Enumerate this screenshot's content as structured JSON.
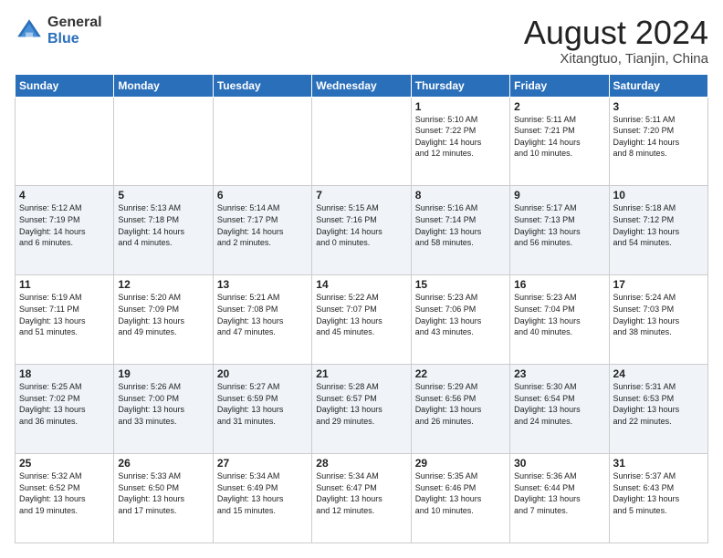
{
  "header": {
    "logo_general": "General",
    "logo_blue": "Blue",
    "month_year": "August 2024",
    "location": "Xitangtuo, Tianjin, China"
  },
  "days_of_week": [
    "Sunday",
    "Monday",
    "Tuesday",
    "Wednesday",
    "Thursday",
    "Friday",
    "Saturday"
  ],
  "weeks": [
    [
      {
        "day": "",
        "info": ""
      },
      {
        "day": "",
        "info": ""
      },
      {
        "day": "",
        "info": ""
      },
      {
        "day": "",
        "info": ""
      },
      {
        "day": "1",
        "info": "Sunrise: 5:10 AM\nSunset: 7:22 PM\nDaylight: 14 hours\nand 12 minutes."
      },
      {
        "day": "2",
        "info": "Sunrise: 5:11 AM\nSunset: 7:21 PM\nDaylight: 14 hours\nand 10 minutes."
      },
      {
        "day": "3",
        "info": "Sunrise: 5:11 AM\nSunset: 7:20 PM\nDaylight: 14 hours\nand 8 minutes."
      }
    ],
    [
      {
        "day": "4",
        "info": "Sunrise: 5:12 AM\nSunset: 7:19 PM\nDaylight: 14 hours\nand 6 minutes."
      },
      {
        "day": "5",
        "info": "Sunrise: 5:13 AM\nSunset: 7:18 PM\nDaylight: 14 hours\nand 4 minutes."
      },
      {
        "day": "6",
        "info": "Sunrise: 5:14 AM\nSunset: 7:17 PM\nDaylight: 14 hours\nand 2 minutes."
      },
      {
        "day": "7",
        "info": "Sunrise: 5:15 AM\nSunset: 7:16 PM\nDaylight: 14 hours\nand 0 minutes."
      },
      {
        "day": "8",
        "info": "Sunrise: 5:16 AM\nSunset: 7:14 PM\nDaylight: 13 hours\nand 58 minutes."
      },
      {
        "day": "9",
        "info": "Sunrise: 5:17 AM\nSunset: 7:13 PM\nDaylight: 13 hours\nand 56 minutes."
      },
      {
        "day": "10",
        "info": "Sunrise: 5:18 AM\nSunset: 7:12 PM\nDaylight: 13 hours\nand 54 minutes."
      }
    ],
    [
      {
        "day": "11",
        "info": "Sunrise: 5:19 AM\nSunset: 7:11 PM\nDaylight: 13 hours\nand 51 minutes."
      },
      {
        "day": "12",
        "info": "Sunrise: 5:20 AM\nSunset: 7:09 PM\nDaylight: 13 hours\nand 49 minutes."
      },
      {
        "day": "13",
        "info": "Sunrise: 5:21 AM\nSunset: 7:08 PM\nDaylight: 13 hours\nand 47 minutes."
      },
      {
        "day": "14",
        "info": "Sunrise: 5:22 AM\nSunset: 7:07 PM\nDaylight: 13 hours\nand 45 minutes."
      },
      {
        "day": "15",
        "info": "Sunrise: 5:23 AM\nSunset: 7:06 PM\nDaylight: 13 hours\nand 43 minutes."
      },
      {
        "day": "16",
        "info": "Sunrise: 5:23 AM\nSunset: 7:04 PM\nDaylight: 13 hours\nand 40 minutes."
      },
      {
        "day": "17",
        "info": "Sunrise: 5:24 AM\nSunset: 7:03 PM\nDaylight: 13 hours\nand 38 minutes."
      }
    ],
    [
      {
        "day": "18",
        "info": "Sunrise: 5:25 AM\nSunset: 7:02 PM\nDaylight: 13 hours\nand 36 minutes."
      },
      {
        "day": "19",
        "info": "Sunrise: 5:26 AM\nSunset: 7:00 PM\nDaylight: 13 hours\nand 33 minutes."
      },
      {
        "day": "20",
        "info": "Sunrise: 5:27 AM\nSunset: 6:59 PM\nDaylight: 13 hours\nand 31 minutes."
      },
      {
        "day": "21",
        "info": "Sunrise: 5:28 AM\nSunset: 6:57 PM\nDaylight: 13 hours\nand 29 minutes."
      },
      {
        "day": "22",
        "info": "Sunrise: 5:29 AM\nSunset: 6:56 PM\nDaylight: 13 hours\nand 26 minutes."
      },
      {
        "day": "23",
        "info": "Sunrise: 5:30 AM\nSunset: 6:54 PM\nDaylight: 13 hours\nand 24 minutes."
      },
      {
        "day": "24",
        "info": "Sunrise: 5:31 AM\nSunset: 6:53 PM\nDaylight: 13 hours\nand 22 minutes."
      }
    ],
    [
      {
        "day": "25",
        "info": "Sunrise: 5:32 AM\nSunset: 6:52 PM\nDaylight: 13 hours\nand 19 minutes."
      },
      {
        "day": "26",
        "info": "Sunrise: 5:33 AM\nSunset: 6:50 PM\nDaylight: 13 hours\nand 17 minutes."
      },
      {
        "day": "27",
        "info": "Sunrise: 5:34 AM\nSunset: 6:49 PM\nDaylight: 13 hours\nand 15 minutes."
      },
      {
        "day": "28",
        "info": "Sunrise: 5:34 AM\nSunset: 6:47 PM\nDaylight: 13 hours\nand 12 minutes."
      },
      {
        "day": "29",
        "info": "Sunrise: 5:35 AM\nSunset: 6:46 PM\nDaylight: 13 hours\nand 10 minutes."
      },
      {
        "day": "30",
        "info": "Sunrise: 5:36 AM\nSunset: 6:44 PM\nDaylight: 13 hours\nand 7 minutes."
      },
      {
        "day": "31",
        "info": "Sunrise: 5:37 AM\nSunset: 6:43 PM\nDaylight: 13 hours\nand 5 minutes."
      }
    ]
  ]
}
